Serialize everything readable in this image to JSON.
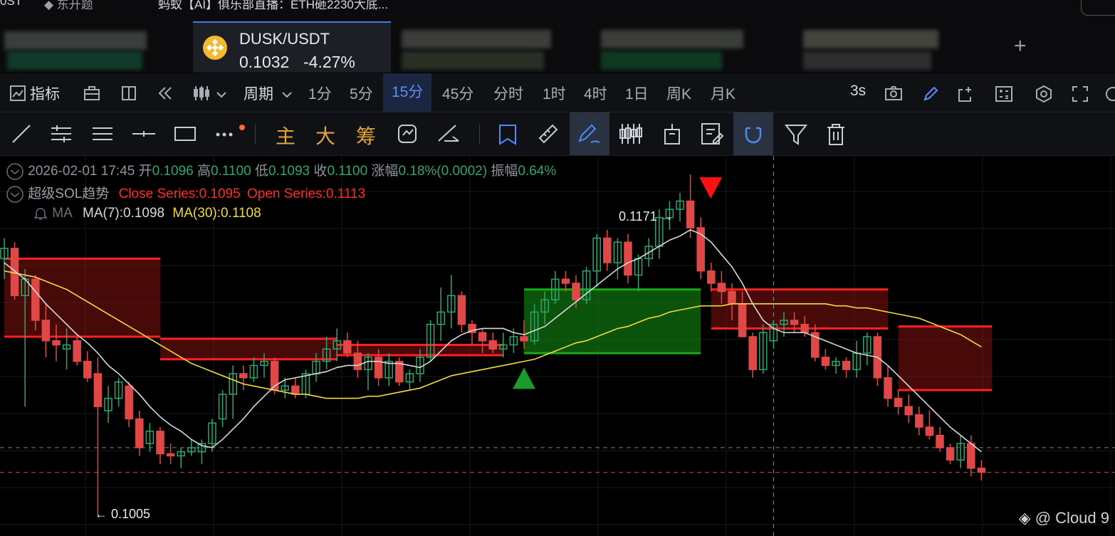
{
  "top_strip": {
    "left_text": "0ST",
    "tag_text": "◆ 东开题",
    "headline": "蚂蚁【AI】俱乐部直播：ETH砸2230大底..."
  },
  "tabs": {
    "active": {
      "symbol": "DUSK/USDT",
      "price": "0.1032",
      "change": "-4.27%"
    },
    "add_label": "+"
  },
  "toolbar1": {
    "indicators_label": "指标",
    "period_label": "周期",
    "intervals": [
      "1分",
      "5分",
      "15分",
      "45分",
      "分时",
      "1时",
      "4时",
      "1日",
      "周K",
      "月K"
    ],
    "active_interval": "15分",
    "refresh_label": "3s"
  },
  "toolbar2": {
    "main_label": "主",
    "big_label": "大",
    "chip_label": "筹"
  },
  "ohlc": {
    "datetime": "2026-02-01 17:45",
    "open_label": "开",
    "open": "0.1096",
    "high_label": "高",
    "high": "0.1100",
    "low_label": "低",
    "low": "0.1093",
    "close_label": "收",
    "close": "0.1100",
    "chg_label": "涨幅",
    "chg": "0.18%(0.0002)",
    "amp_label": "振幅",
    "amp": "0.64%"
  },
  "indicator_sol": {
    "name": "超级SOL趋势",
    "close_series": "Close Series:0.1095",
    "open_series": "Open Series:0.1113"
  },
  "indicator_ma": {
    "name": "MA",
    "ma7": "MA(7):0.1098",
    "ma30": "MA(30):0.1108"
  },
  "annotations": {
    "high_mark": "0.1171 →",
    "low_mark": "← 0.1005"
  },
  "watermark": "◈ @ Cloud 9",
  "colors": {
    "up": "#2ea66f",
    "down": "#e04848",
    "ma7": "#d9d9d9",
    "ma30": "#f0dc3c",
    "band_red": "#ff2020",
    "band_green": "#18a818",
    "accent": "#3c7cf0"
  },
  "chart_data": {
    "type": "candlestick",
    "y_range": [
      0.0995,
      0.118
    ],
    "candles": [
      [
        0.113,
        0.114,
        0.112,
        0.1135
      ],
      [
        0.1135,
        0.1138,
        0.111,
        0.1112
      ],
      [
        0.1112,
        0.1125,
        0.1058,
        0.112
      ],
      [
        0.112,
        0.1122,
        0.1095,
        0.11
      ],
      [
        0.11,
        0.1108,
        0.1082,
        0.109
      ],
      [
        0.109,
        0.1098,
        0.108,
        0.1088
      ],
      [
        0.1086,
        0.1096,
        0.1076,
        0.1088
      ],
      [
        0.109,
        0.1092,
        0.1078,
        0.108
      ],
      [
        0.108,
        0.1085,
        0.107,
        0.1072
      ],
      [
        0.1074,
        0.1082,
        0.1005,
        0.1058
      ],
      [
        0.1056,
        0.1068,
        0.105,
        0.1062
      ],
      [
        0.1062,
        0.1072,
        0.1058,
        0.107
      ],
      [
        0.1068,
        0.107,
        0.1048,
        0.1052
      ],
      [
        0.1052,
        0.1056,
        0.1034,
        0.1038
      ],
      [
        0.104,
        0.105,
        0.1036,
        0.1046
      ],
      [
        0.1046,
        0.1048,
        0.103,
        0.1035
      ],
      [
        0.1035,
        0.104,
        0.103,
        0.1034
      ],
      [
        0.1034,
        0.1038,
        0.1028,
        0.1036
      ],
      [
        0.1036,
        0.1042,
        0.1034,
        0.1038
      ],
      [
        0.1036,
        0.1042,
        0.103,
        0.104
      ],
      [
        0.104,
        0.1052,
        0.1036,
        0.105
      ],
      [
        0.1052,
        0.1066,
        0.1048,
        0.1064
      ],
      [
        0.1064,
        0.1078,
        0.1052,
        0.1074
      ],
      [
        0.1074,
        0.1078,
        0.1066,
        0.1072
      ],
      [
        0.1072,
        0.1082,
        0.107,
        0.1078
      ],
      [
        0.1078,
        0.1084,
        0.1072,
        0.108
      ],
      [
        0.108,
        0.1082,
        0.1064,
        0.1066
      ],
      [
        0.1066,
        0.1072,
        0.1062,
        0.1068
      ],
      [
        0.1068,
        0.1072,
        0.1062,
        0.1064
      ],
      [
        0.1064,
        0.1076,
        0.1062,
        0.1074
      ],
      [
        0.1074,
        0.1084,
        0.107,
        0.108
      ],
      [
        0.108,
        0.1092,
        0.1076,
        0.1086
      ],
      [
        0.1086,
        0.1096,
        0.108,
        0.109
      ],
      [
        0.109,
        0.1094,
        0.1082,
        0.1084
      ],
      [
        0.1084,
        0.109,
        0.1072,
        0.1076
      ],
      [
        0.1076,
        0.1084,
        0.1066,
        0.1082
      ],
      [
        0.1082,
        0.1086,
        0.1068,
        0.1072
      ],
      [
        0.1072,
        0.1084,
        0.1068,
        0.108
      ],
      [
        0.108,
        0.1082,
        0.1068,
        0.107
      ],
      [
        0.107,
        0.1076,
        0.1066,
        0.1074
      ],
      [
        0.1074,
        0.1086,
        0.107,
        0.1082
      ],
      [
        0.1082,
        0.11,
        0.108,
        0.1098
      ],
      [
        0.1098,
        0.1116,
        0.109,
        0.1104
      ],
      [
        0.1104,
        0.1122,
        0.1096,
        0.1112
      ],
      [
        0.1112,
        0.1114,
        0.1094,
        0.1098
      ],
      [
        0.1098,
        0.11,
        0.1088,
        0.1094
      ],
      [
        0.1094,
        0.1096,
        0.1084,
        0.109
      ],
      [
        0.109,
        0.1094,
        0.1084,
        0.1086
      ],
      [
        0.1086,
        0.1094,
        0.1082,
        0.1088
      ],
      [
        0.1088,
        0.1096,
        0.1084,
        0.1092
      ],
      [
        0.1092,
        0.11,
        0.1086,
        0.109
      ],
      [
        0.109,
        0.1108,
        0.1088,
        0.1104
      ],
      [
        0.1104,
        0.1114,
        0.1098,
        0.111
      ],
      [
        0.111,
        0.1124,
        0.1108,
        0.112
      ],
      [
        0.112,
        0.1124,
        0.1114,
        0.1118
      ],
      [
        0.1118,
        0.1122,
        0.1106,
        0.111
      ],
      [
        0.111,
        0.1126,
        0.1108,
        0.1124
      ],
      [
        0.1124,
        0.1142,
        0.1116,
        0.114
      ],
      [
        0.114,
        0.1144,
        0.1124,
        0.1128
      ],
      [
        0.1128,
        0.114,
        0.112,
        0.1138
      ],
      [
        0.1138,
        0.1142,
        0.1118,
        0.1122
      ],
      [
        0.1122,
        0.1132,
        0.1114,
        0.113
      ],
      [
        0.113,
        0.114,
        0.1126,
        0.1136
      ],
      [
        0.1136,
        0.1154,
        0.113,
        0.115
      ],
      [
        0.115,
        0.1158,
        0.1144,
        0.1154
      ],
      [
        0.1154,
        0.1162,
        0.1148,
        0.1158
      ],
      [
        0.1158,
        0.1171,
        0.114,
        0.1145
      ],
      [
        0.1145,
        0.115,
        0.112,
        0.1124
      ],
      [
        0.1124,
        0.1128,
        0.1114,
        0.1118
      ],
      [
        0.1118,
        0.1124,
        0.1108,
        0.1114
      ],
      [
        0.1114,
        0.1118,
        0.11,
        0.1108
      ],
      [
        0.1108,
        0.1114,
        0.1094,
        0.1092
      ],
      [
        0.1092,
        0.1094,
        0.1072,
        0.1076
      ],
      [
        0.1076,
        0.1098,
        0.1074,
        0.1094
      ],
      [
        0.109,
        0.11,
        0.1086,
        0.1098
      ],
      [
        0.1098,
        0.1104,
        0.1092,
        0.11
      ],
      [
        0.11,
        0.1104,
        0.1094,
        0.1098
      ],
      [
        0.1098,
        0.1102,
        0.1092,
        0.1094
      ],
      [
        0.1094,
        0.1098,
        0.108,
        0.1082
      ],
      [
        0.1082,
        0.1086,
        0.1076,
        0.1078
      ],
      [
        0.1078,
        0.1082,
        0.1074,
        0.108
      ],
      [
        0.108,
        0.1082,
        0.1072,
        0.1076
      ],
      [
        0.1076,
        0.109,
        0.1072,
        0.1084
      ],
      [
        0.1084,
        0.1094,
        0.1078,
        0.1092
      ],
      [
        0.1092,
        0.1094,
        0.1068,
        0.1072
      ],
      [
        0.1072,
        0.1078,
        0.1058,
        0.1062
      ],
      [
        0.1062,
        0.1066,
        0.1054,
        0.1058
      ],
      [
        0.1058,
        0.1064,
        0.105,
        0.1054
      ],
      [
        0.1054,
        0.1058,
        0.1044,
        0.1048
      ],
      [
        0.1048,
        0.1056,
        0.1042,
        0.1044
      ],
      [
        0.1044,
        0.1048,
        0.1036,
        0.1038
      ],
      [
        0.1038,
        0.104,
        0.103,
        0.1032
      ],
      [
        0.1032,
        0.1044,
        0.1028,
        0.104
      ],
      [
        0.104,
        0.1044,
        0.1024,
        0.1028
      ],
      [
        0.1028,
        0.1032,
        0.1022,
        0.1026
      ]
    ],
    "ma7": [
      0.1128,
      0.1124,
      0.112,
      0.1114,
      0.1108,
      0.1103,
      0.1098,
      0.1093,
      0.1089,
      0.1084,
      0.1078,
      0.1074,
      0.1069,
      0.1064,
      0.1058,
      0.1053,
      0.1049,
      0.1046,
      0.1042,
      0.1039,
      0.1038,
      0.1042,
      0.1047,
      0.1052,
      0.1058,
      0.1063,
      0.1068,
      0.1071,
      0.1072,
      0.1073,
      0.1074,
      0.1075,
      0.1077,
      0.1078,
      0.1078,
      0.108,
      0.108,
      0.1079,
      0.1079,
      0.1078,
      0.1077,
      0.108,
      0.1085,
      0.109,
      0.1093,
      0.1095,
      0.1096,
      0.1096,
      0.1096,
      0.1094,
      0.1093,
      0.1095,
      0.1097,
      0.1101,
      0.1105,
      0.1109,
      0.1113,
      0.1117,
      0.1121,
      0.1125,
      0.1128,
      0.113,
      0.1133,
      0.1136,
      0.1139,
      0.1141,
      0.1144,
      0.1142,
      0.1138,
      0.1132,
      0.1126,
      0.1118,
      0.1108,
      0.11,
      0.1096,
      0.1094,
      0.1094,
      0.1094,
      0.1092,
      0.109,
      0.1088,
      0.1086,
      0.1084,
      0.1083,
      0.1082,
      0.1078,
      0.1073,
      0.1068,
      0.1063,
      0.1058,
      0.1053,
      0.1048,
      0.1044,
      0.104,
      0.1036
    ],
    "ma30": [
      0.1124,
      0.1123,
      0.1122,
      0.1121,
      0.1119,
      0.1117,
      0.1115,
      0.1112,
      0.1109,
      0.1106,
      0.1103,
      0.11,
      0.1097,
      0.1094,
      0.1091,
      0.1088,
      0.1085,
      0.1082,
      0.1079,
      0.1077,
      0.1075,
      0.1073,
      0.1071,
      0.1069,
      0.1068,
      0.1067,
      0.1066,
      0.1065,
      0.1064,
      0.1064,
      0.1063,
      0.1062,
      0.1062,
      0.1062,
      0.1062,
      0.1063,
      0.1063,
      0.1064,
      0.1065,
      0.1066,
      0.1067,
      0.1069,
      0.1071,
      0.1073,
      0.1074,
      0.1075,
      0.1076,
      0.1077,
      0.1078,
      0.1079,
      0.108,
      0.1081,
      0.1083,
      0.1085,
      0.1087,
      0.1089,
      0.109,
      0.1092,
      0.1094,
      0.1096,
      0.1097,
      0.1099,
      0.1101,
      0.1102,
      0.1104,
      0.1105,
      0.1106,
      0.1107,
      0.1107,
      0.1107,
      0.1108,
      0.1108,
      0.1108,
      0.1108,
      0.1108,
      0.1108,
      0.1108,
      0.1108,
      0.1108,
      0.1108,
      0.1107,
      0.1107,
      0.1106,
      0.1106,
      0.1105,
      0.1104,
      0.1103,
      0.1102,
      0.1101,
      0.1099,
      0.1097,
      0.1095,
      0.1093,
      0.109,
      0.1087
    ],
    "bands": [
      {
        "type": "bearish",
        "from": 0,
        "to": 15,
        "upper": 0.113,
        "lower": 0.1092
      },
      {
        "type": "bearish",
        "from": 15,
        "to": 32,
        "upper": 0.1091,
        "lower": 0.1081
      },
      {
        "type": "bearish",
        "from": 32,
        "to": 48,
        "upper": 0.1088,
        "lower": 0.1083
      },
      {
        "type": "bullish",
        "from": 50,
        "to": 67,
        "upper": 0.1115,
        "lower": 0.1084
      },
      {
        "type": "bearish",
        "from": 68,
        "to": 85,
        "upper": 0.1115,
        "lower": 0.1096
      },
      {
        "type": "bearish",
        "from": 86,
        "to": 95,
        "upper": 0.1097,
        "lower": 0.1066
      }
    ],
    "buy_signal_index": 50,
    "sell_signal_index": 67,
    "h_lines": [
      {
        "value": 0.1038,
        "style": "dashed-grey"
      },
      {
        "value": 0.1026,
        "style": "dashed-red"
      }
    ],
    "crosshair_index": 74
  }
}
